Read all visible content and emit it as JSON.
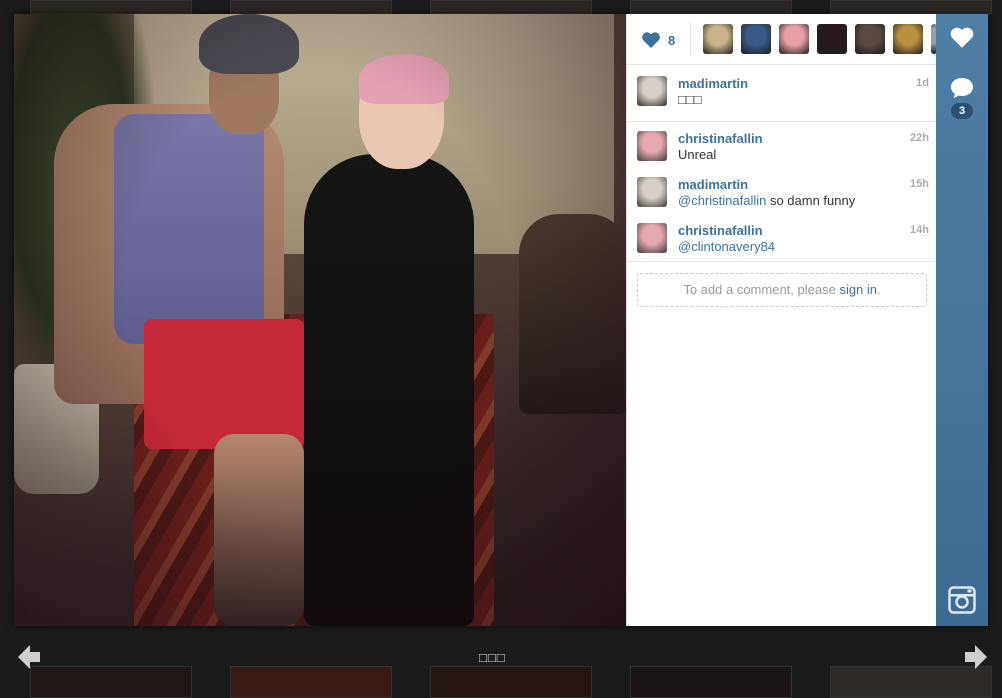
{
  "likes": {
    "count": "8",
    "avatar_colors": [
      "#c9b48a",
      "#3a5a8a",
      "#e8a0a8",
      "#2a1a20",
      "#5a4a44",
      "#b89040",
      "#9aa0a6"
    ]
  },
  "caption": {
    "username": "madimartin",
    "time": "1d",
    "text": "□□□",
    "avatar_color": "#d8d0c8"
  },
  "comments": [
    {
      "username": "christinafallin",
      "time": "22h",
      "mention": "",
      "text": "Unreal",
      "avatar_color": "#e6a8b0"
    },
    {
      "username": "madimartin",
      "time": "15h",
      "mention": "@christinafallin",
      "text": " so damn funny",
      "avatar_color": "#d8d0c8"
    },
    {
      "username": "christinafallin",
      "time": "14h",
      "mention": "@clintonavery84",
      "text": "",
      "avatar_color": "#e6a8b0"
    }
  ],
  "add_comment": {
    "prefix": "To add a comment, please ",
    "link": "sign in",
    "suffix": "."
  },
  "actions": {
    "comment_count": "3"
  },
  "footer": {
    "page_text": "□□□"
  },
  "colors": {
    "accent": "#3f729b",
    "action_bar": "#4a7aa3"
  },
  "icons": [
    "heart-icon",
    "comment-bubble-icon",
    "instagram-camera-icon",
    "arrow-left-icon",
    "arrow-right-icon"
  ]
}
